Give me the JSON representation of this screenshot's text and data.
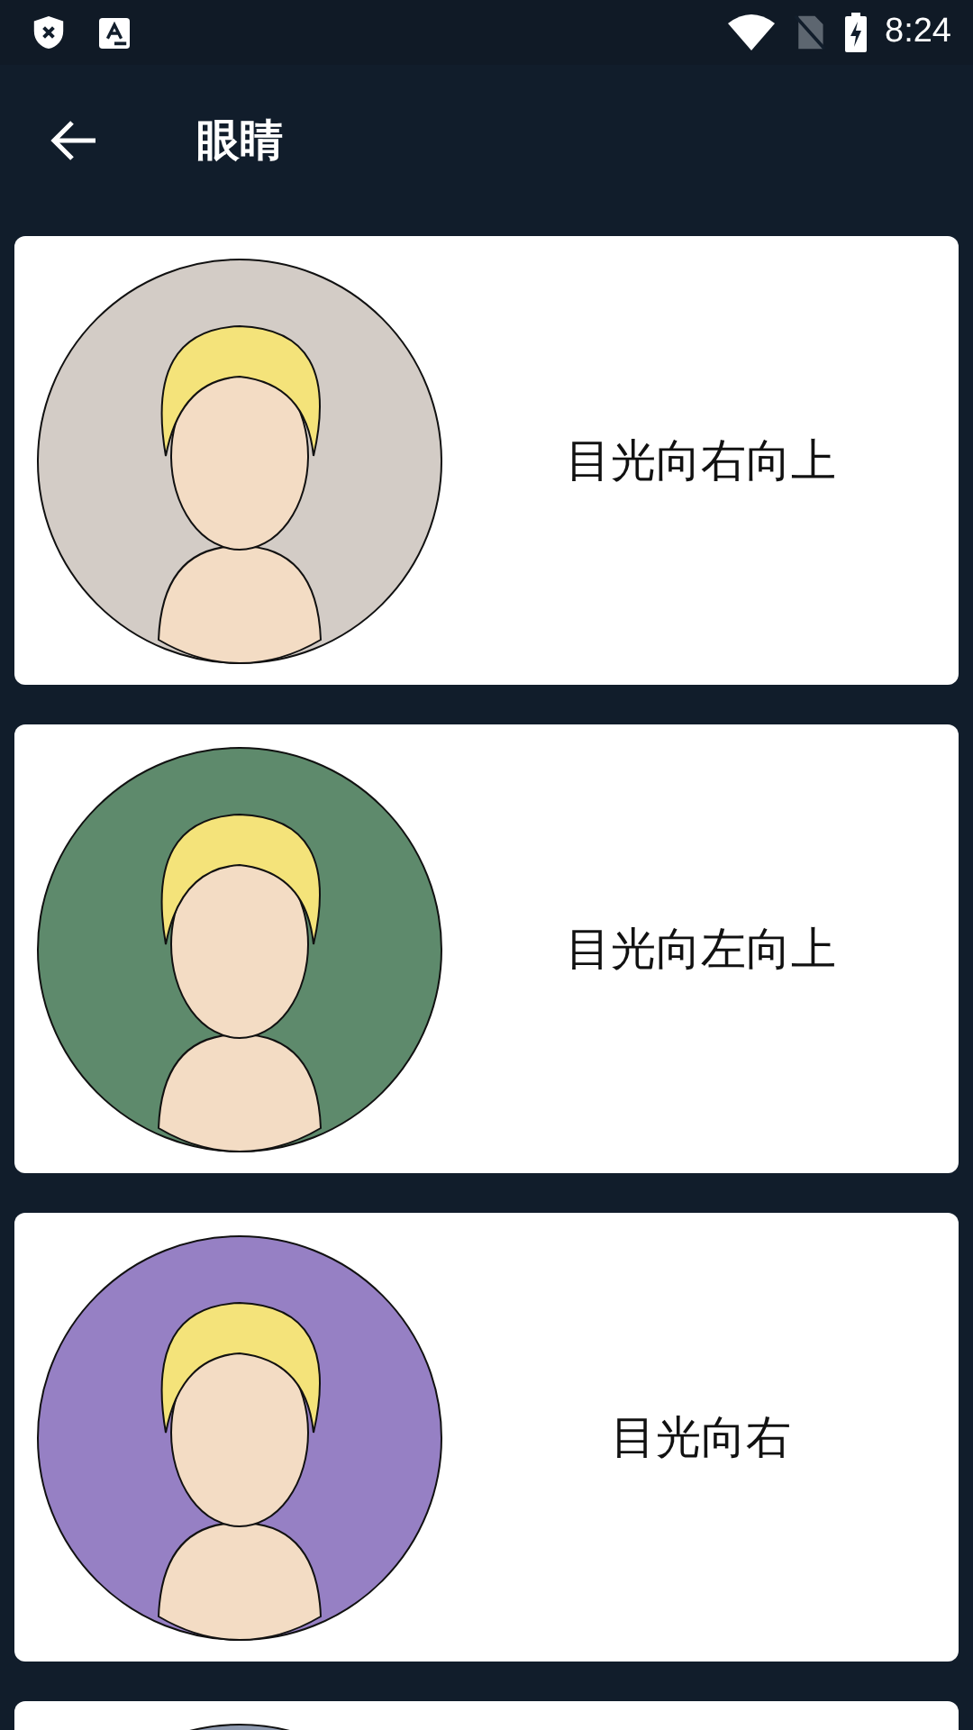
{
  "status_bar": {
    "time": "8:24"
  },
  "app_bar": {
    "title": "眼睛"
  },
  "items": [
    {
      "label": "目光向右向上",
      "color": "#d3ccc6"
    },
    {
      "label": "目光向左向上",
      "color": "#5e8a6c"
    },
    {
      "label": "目光向右",
      "color": "#9680c4"
    },
    {
      "color": "#8e9ab0"
    }
  ]
}
